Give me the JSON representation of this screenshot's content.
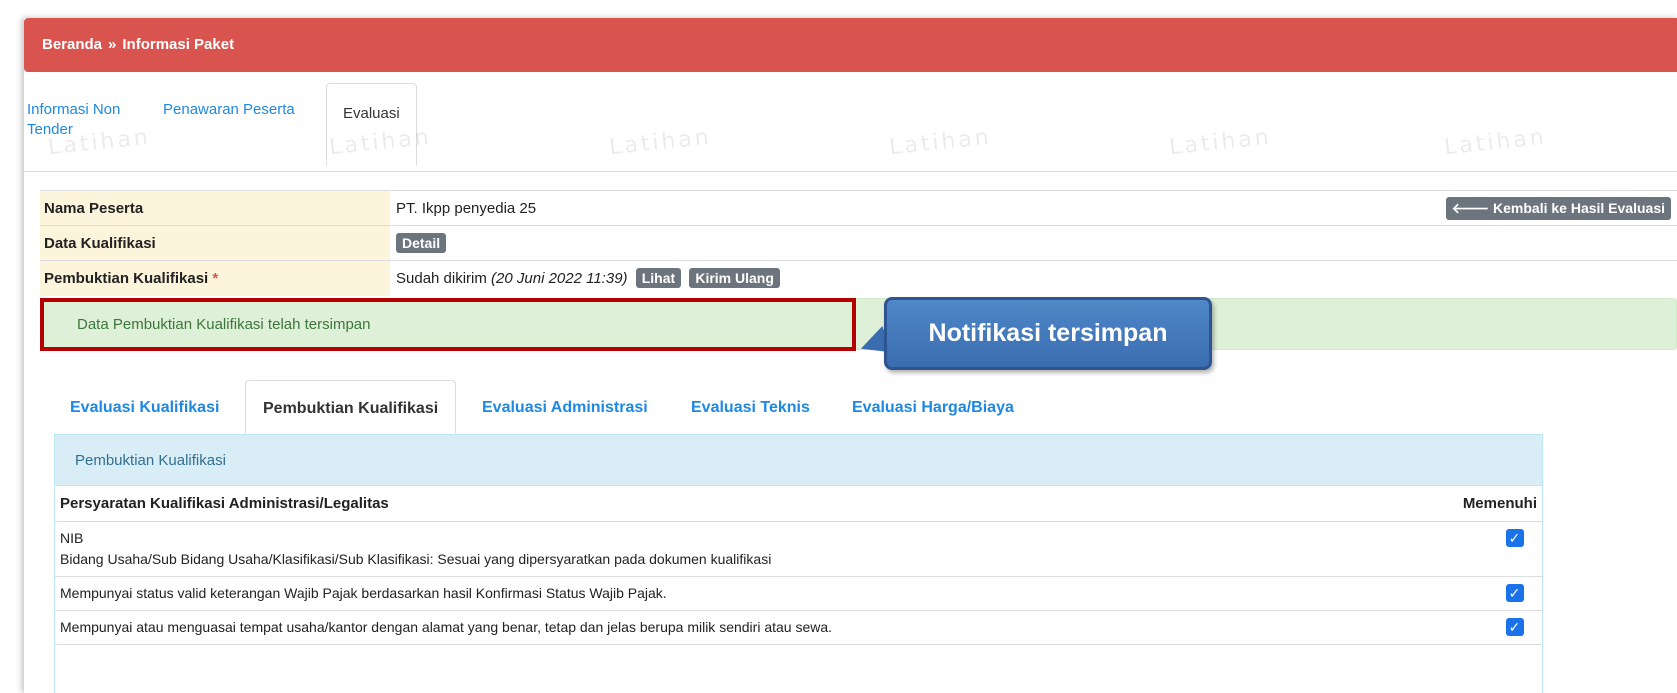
{
  "breadcrumb": {
    "home": "Beranda",
    "separator": "»",
    "current": "Informasi Paket"
  },
  "top_tabs": [
    {
      "label": "Informasi Non Tender",
      "active": false
    },
    {
      "label": "Penawaran Peserta",
      "active": false
    },
    {
      "label": "Evaluasi",
      "active": true
    }
  ],
  "watermark": "Latihan",
  "info": {
    "nama_peserta_label": "Nama Peserta",
    "nama_peserta_value": "PT. Ikpp penyedia 25",
    "back_button": "Kembali ke Hasil Evaluasi",
    "data_kualifikasi_label": "Data Kualifikasi",
    "detail_button": "Detail",
    "pembuktian_label": "Pembuktian Kualifikasi",
    "required_mark": "*",
    "pembuktian_status": "Sudah dikirim",
    "pembuktian_date": "(20 Juni 2022 11:39)",
    "lihat_button": "Lihat",
    "kirim_ulang_button": "Kirim Ulang"
  },
  "alert": {
    "message": "Data Pembuktian Kualifikasi telah tersimpan"
  },
  "callout": {
    "text": "Notifikasi tersimpan"
  },
  "sub_tabs": [
    {
      "label": "Evaluasi Kualifikasi",
      "active": false
    },
    {
      "label": "Pembuktian Kualifikasi",
      "active": true
    },
    {
      "label": "Evaluasi Administrasi",
      "active": false
    },
    {
      "label": "Evaluasi Teknis",
      "active": false
    },
    {
      "label": "Evaluasi Harga/Biaya",
      "active": false
    }
  ],
  "panel": {
    "title": "Pembuktian Kualifikasi",
    "column_requirement": "Persyaratan Kualifikasi Administrasi/Legalitas",
    "column_status": "Memenuhi",
    "rows": [
      {
        "line1": "NIB",
        "line2": "Bidang Usaha/Sub Bidang Usaha/Klasifikasi/Sub Klasifikasi: Sesuai yang dipersyaratkan pada dokumen kualifikasi",
        "checked": true
      },
      {
        "line1": "Mempunyai status valid keterangan Wajib Pajak berdasarkan hasil Konfirmasi Status Wajib Pajak.",
        "line2": "",
        "checked": true
      },
      {
        "line1": "Mempunyai atau menguasai tempat usaha/kantor dengan alamat yang benar, tetap dan jelas berupa milik sendiri atau sewa.",
        "line2": "",
        "checked": true
      }
    ]
  },
  "colors": {
    "header": "#d9534f",
    "link": "#1e88e5",
    "alert_bg": "#dff0d8",
    "callout": "#3a6db0",
    "checkbox": "#1a73e8"
  }
}
